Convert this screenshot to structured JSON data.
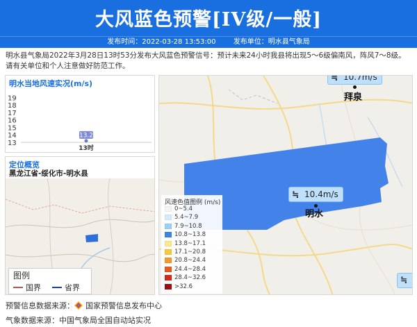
{
  "header": {
    "title": "大风蓝色预警[IV级/一般]",
    "publish_time_label": "发布时间：2022-03-28 13:53:00",
    "publish_unit_label": "发布单位：明水县气象局"
  },
  "description": "明水县气象局2022年3月28日13时53分发布大风蓝色预警信号：预计未来24小时我县将出现5～6级偏南风，阵风7～8级。请有关单位和个人注意做好防范工作。",
  "wind_panel": {
    "title": "明水当地风速实况(m/s)"
  },
  "chart_data": {
    "type": "line",
    "title": "明水当地风速实况(m/s)",
    "categories": [
      "13时"
    ],
    "series": [
      {
        "values": [
          13.2
        ]
      }
    ],
    "data_labels": [
      "13.2"
    ],
    "y_ticks": [
      13,
      14,
      15,
      16,
      17,
      18,
      19
    ],
    "ylim": [
      13,
      19.5
    ],
    "grid": false
  },
  "location": {
    "title": "定位概览",
    "path": "黑龙江省-绥化市-明水县",
    "legend_title": "图例",
    "legend_items": [
      {
        "label": "国界",
        "color": "#c0504d"
      },
      {
        "label": "省界",
        "color": "#1a3fb0"
      }
    ]
  },
  "main_map": {
    "tags": [
      {
        "value": "10.7m/s",
        "icon": "wind-icon"
      },
      {
        "value": "10.4m/s",
        "icon": "wind-icon"
      }
    ],
    "cities": [
      "拜泉",
      "明水"
    ],
    "warning_area_color": "#3d7fe8"
  },
  "speed_legend": {
    "title": "风速色值图例 (m/s)",
    "ranges": [
      {
        "label": "0~5.4",
        "color": "#f4f4f4"
      },
      {
        "label": "5.4~7.9",
        "color": "#d6eafb"
      },
      {
        "label": "7.9~10.8",
        "color": "#9ccff5"
      },
      {
        "label": "10.8~13.8",
        "color": "#3d85e0"
      },
      {
        "label": "13.8~17.1",
        "color": "#fde98a"
      },
      {
        "label": "17.1~20.8",
        "color": "#f7c83a"
      },
      {
        "label": "20.8~24.4",
        "color": "#f39a2b"
      },
      {
        "label": "24.4~28.4",
        "color": "#ea5a1e"
      },
      {
        "label": "28.4~32.6",
        "color": "#d42a1a"
      },
      {
        "label": ">32.6",
        "color": "#9a0f0f"
      }
    ]
  },
  "footer": {
    "warning_source": "预警信息数据来源：",
    "warning_source_name": "国家预警信息发布中心",
    "weather_source": "气象数据来源：中国气象局全国自动站实况"
  }
}
